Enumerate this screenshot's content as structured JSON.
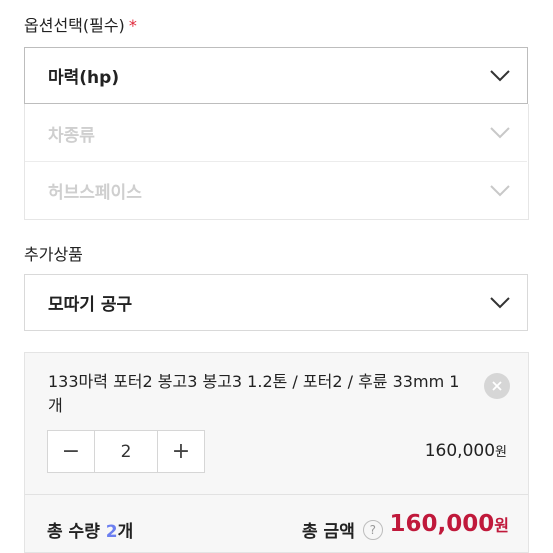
{
  "options": {
    "label": "옵션선택(필수)",
    "required_mark": "*",
    "selects": [
      {
        "value": "마력(hp)",
        "disabled": false
      },
      {
        "value": "차종류",
        "disabled": true
      },
      {
        "value": "허브스페이스",
        "disabled": true
      }
    ]
  },
  "addons": {
    "label": "추가상품",
    "select_value": "모따기 공구"
  },
  "cart_item": {
    "name": "133마력 포터2 봉고3 봉고3 1.2톤 / 포터2 / 후륜 33mm 1개",
    "quantity": "2",
    "minus": "−",
    "plus": "+",
    "price": "160,000",
    "currency": "원"
  },
  "summary": {
    "qty_label": "총 수량 ",
    "qty_value": "2",
    "qty_unit": "개",
    "amount_label": "총 금액",
    "help": "?",
    "amount_value": "160,000",
    "currency": "원"
  },
  "colors": {
    "accent_red": "#c0193b",
    "qty_blue": "#6c7ff0",
    "required_star": "#e0283a"
  },
  "icons": [
    "chevron-down-icon",
    "close-icon",
    "help-icon"
  ]
}
